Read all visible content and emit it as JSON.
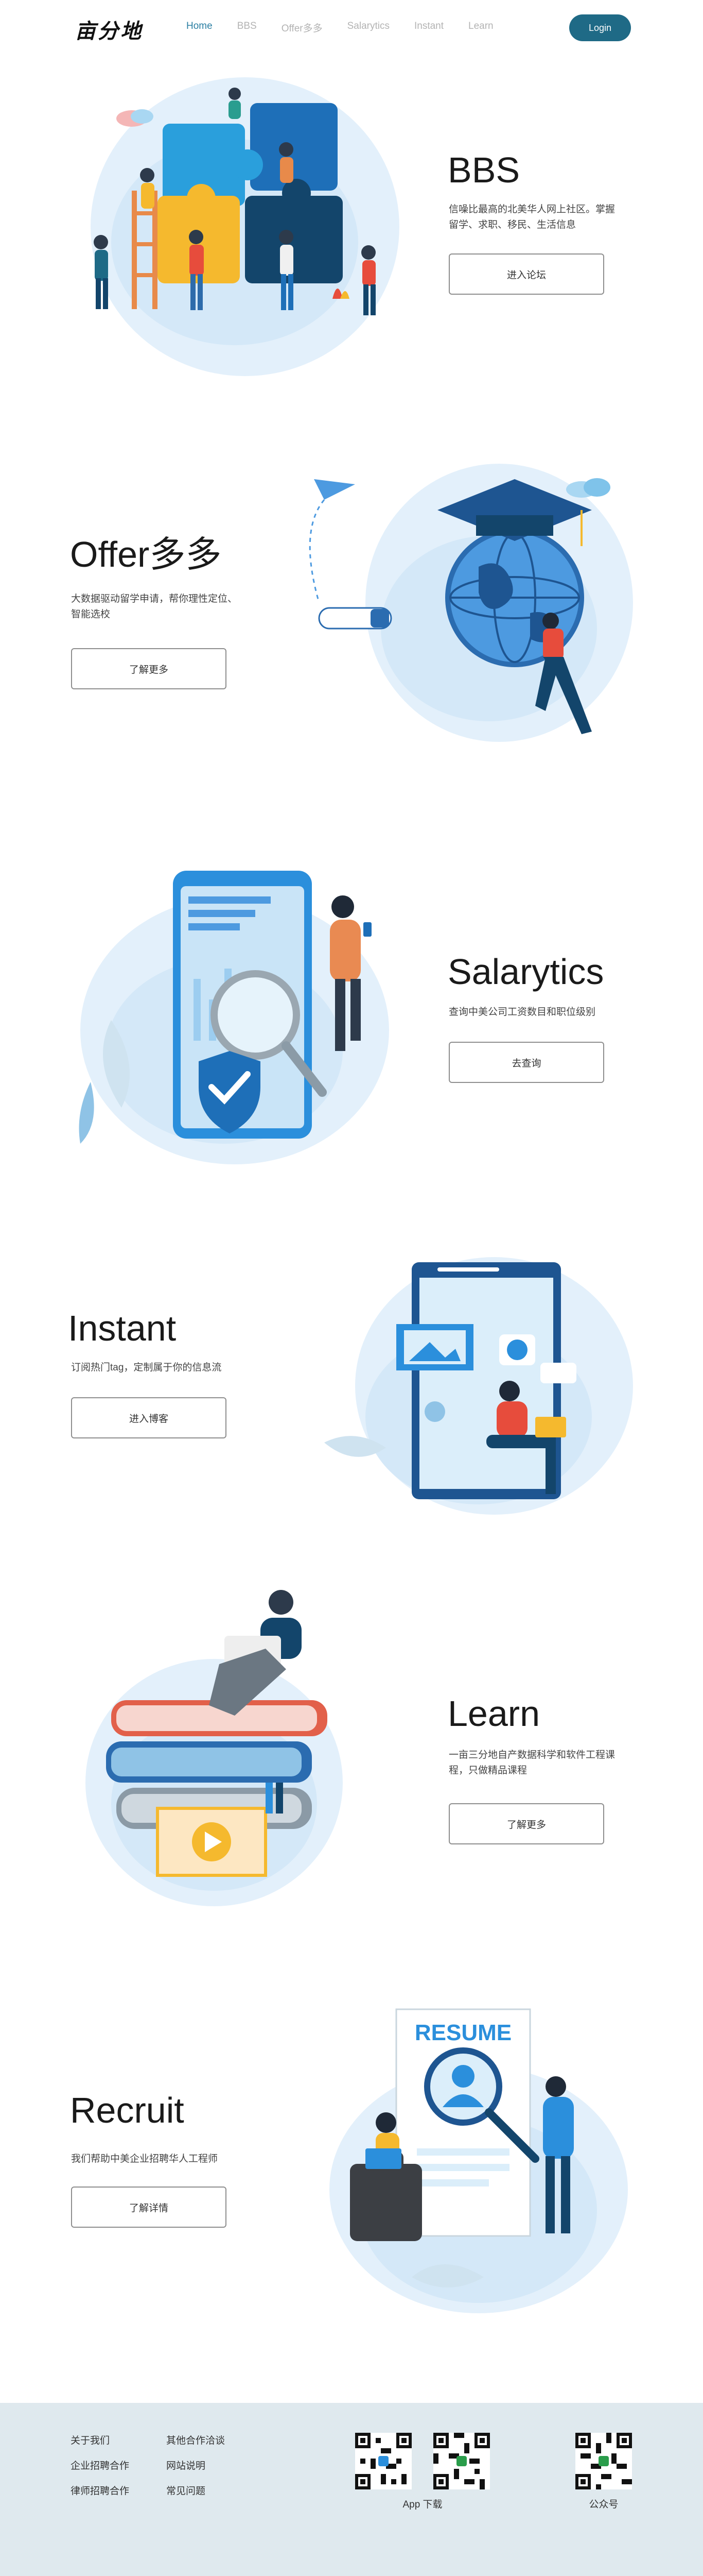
{
  "header": {
    "logo_text": "亩分地",
    "nav": [
      {
        "label": "Home"
      },
      {
        "label": "BBS"
      },
      {
        "label": "Offer多多"
      },
      {
        "label": "Salarytics"
      },
      {
        "label": "Instant"
      },
      {
        "label": "Learn"
      }
    ],
    "login_label": "Login"
  },
  "sections": {
    "bbs": {
      "title": "BBS",
      "desc": "信噪比最高的北美华人网上社区。掌握留学、求职、移民、生活信息",
      "button": "进入论坛"
    },
    "offer": {
      "title": "Offer多多",
      "desc": "大数据驱动留学申请，帮你理性定位、智能选校",
      "button": "了解更多"
    },
    "salarytics": {
      "title": "Salarytics",
      "desc": "查询中美公司工资数目和职位级别",
      "button": "去查询"
    },
    "instant": {
      "title": "Instant",
      "desc": "订阅热门tag，定制属于你的信息流",
      "button": "进入博客"
    },
    "learn": {
      "title": "Learn",
      "desc": "一亩三分地自产数据科学和软件工程课程，只做精品课程",
      "button": "了解更多"
    },
    "recruit": {
      "title": "Recruit",
      "desc": "我们帮助中美企业招聘华人工程师",
      "button": "了解详情",
      "resume_label": "RESUME"
    }
  },
  "footer": {
    "links": [
      "关于我们",
      "其他合作洽谈",
      "企业招聘合作",
      "网站说明",
      "律师招聘合作",
      "常见问题"
    ],
    "app_caption": "App 下载",
    "wechat_caption": "公众号"
  },
  "colors": {
    "accent": "#1f6a86",
    "nav_active": "#2b7fa3",
    "blob": "#e3f0fb",
    "footer_bg": "#dfe9ee"
  }
}
